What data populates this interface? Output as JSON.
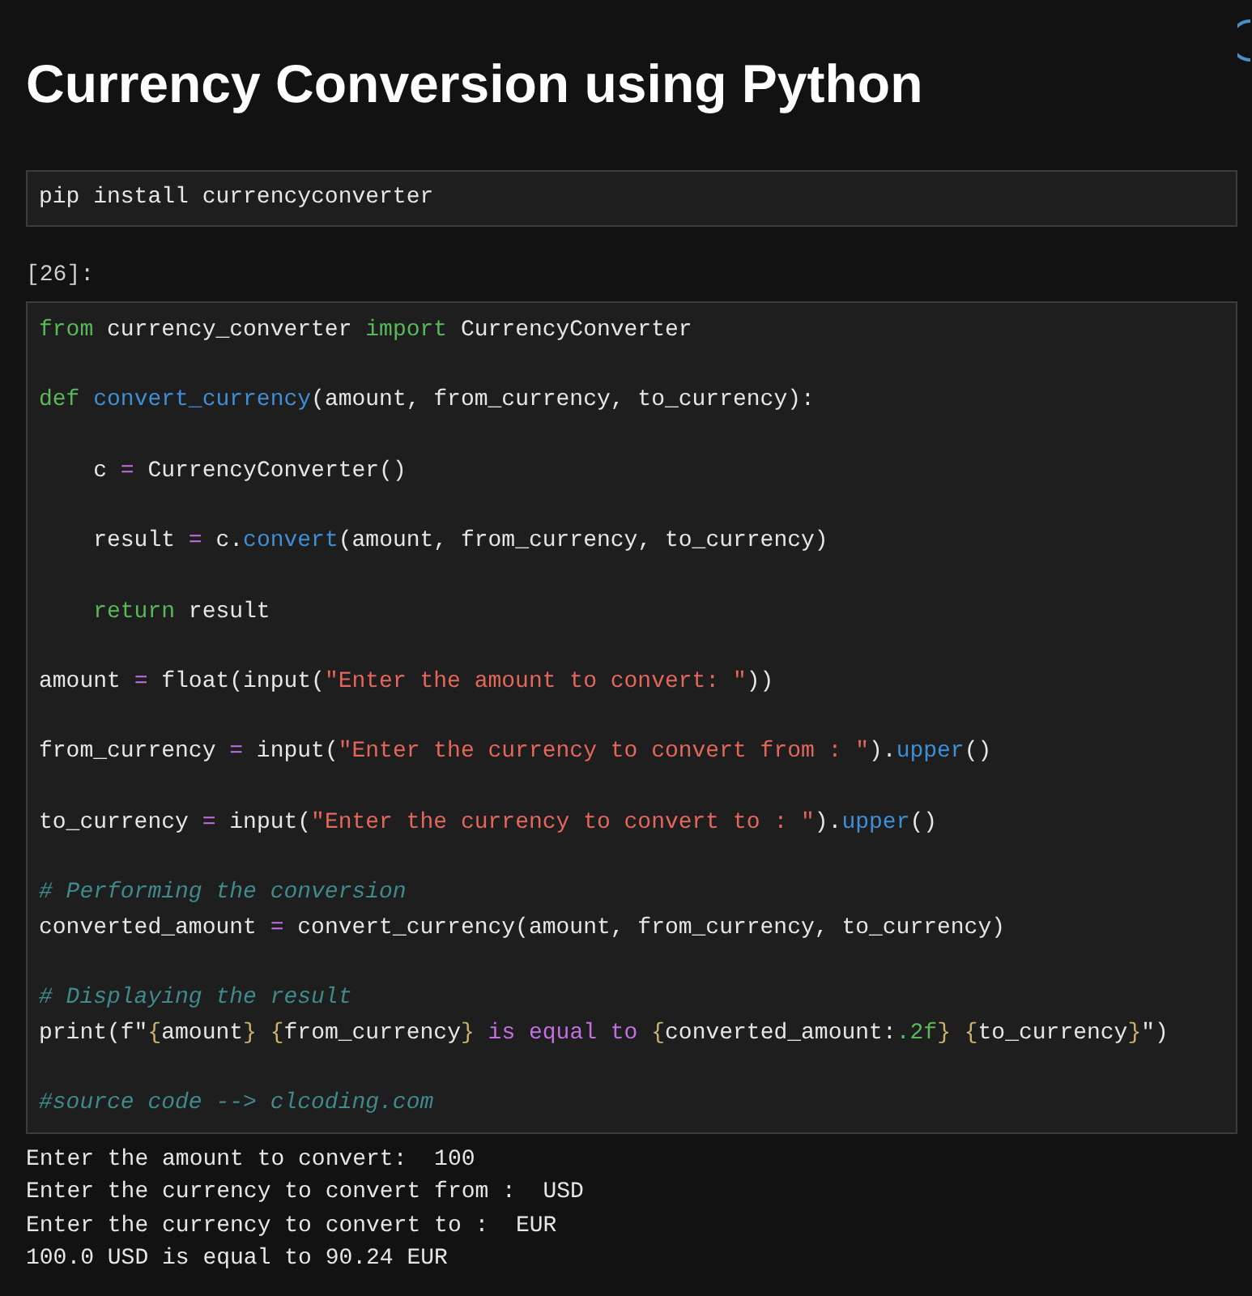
{
  "title": "Currency Conversion using Python",
  "install_cell": {
    "code": "pip install currencyconverter"
  },
  "prompt": "[26]:",
  "code_cell": {
    "lines": [
      {
        "kind": "code",
        "tokens": [
          {
            "text": "from",
            "kind": "keyword"
          },
          {
            "text": " currency_converter ",
            "kind": "plain"
          },
          {
            "text": "import",
            "kind": "keyword"
          },
          {
            "text": " CurrencyConverter",
            "kind": "plain"
          }
        ]
      },
      {
        "kind": "blank"
      },
      {
        "kind": "code",
        "tokens": [
          {
            "text": "def",
            "kind": "keyword"
          },
          {
            "text": " convert_currency",
            "kind": "function"
          },
          {
            "text": "(amount, from_currency, to_currency):",
            "kind": "plain"
          }
        ]
      },
      {
        "kind": "blank"
      },
      {
        "kind": "code",
        "tokens": [
          {
            "text": "    c ",
            "kind": "plain"
          },
          {
            "text": "=",
            "kind": "operator"
          },
          {
            "text": " CurrencyConverter()",
            "kind": "plain"
          }
        ]
      },
      {
        "kind": "blank"
      },
      {
        "kind": "code",
        "tokens": [
          {
            "text": "    result ",
            "kind": "plain"
          },
          {
            "text": "=",
            "kind": "operator"
          },
          {
            "text": " c.",
            "kind": "plain"
          },
          {
            "text": "convert",
            "kind": "function"
          },
          {
            "text": "(amount, from_currency, to_currency)",
            "kind": "plain"
          }
        ]
      },
      {
        "kind": "blank"
      },
      {
        "kind": "code",
        "tokens": [
          {
            "text": "    return",
            "kind": "keyword"
          },
          {
            "text": " result",
            "kind": "plain"
          }
        ]
      },
      {
        "kind": "blank"
      },
      {
        "kind": "code",
        "tokens": [
          {
            "text": "amount ",
            "kind": "plain"
          },
          {
            "text": "=",
            "kind": "operator"
          },
          {
            "text": " float(input(",
            "kind": "plain"
          },
          {
            "text": "\"Enter the amount to convert: \"",
            "kind": "string"
          },
          {
            "text": "))",
            "kind": "plain"
          }
        ]
      },
      {
        "kind": "blank"
      },
      {
        "kind": "code",
        "tokens": [
          {
            "text": "from_currency ",
            "kind": "plain"
          },
          {
            "text": "=",
            "kind": "operator"
          },
          {
            "text": " input(",
            "kind": "plain"
          },
          {
            "text": "\"Enter the currency to convert from : \"",
            "kind": "string"
          },
          {
            "text": ").",
            "kind": "plain"
          },
          {
            "text": "upper",
            "kind": "function"
          },
          {
            "text": "()",
            "kind": "plain"
          }
        ]
      },
      {
        "kind": "blank"
      },
      {
        "kind": "code",
        "tokens": [
          {
            "text": "to_currency ",
            "kind": "plain"
          },
          {
            "text": "=",
            "kind": "operator"
          },
          {
            "text": " input(",
            "kind": "plain"
          },
          {
            "text": "\"Enter the currency to convert to : \"",
            "kind": "string"
          },
          {
            "text": ").",
            "kind": "plain"
          },
          {
            "text": "upper",
            "kind": "function"
          },
          {
            "text": "()",
            "kind": "plain"
          }
        ]
      },
      {
        "kind": "blank"
      },
      {
        "kind": "code",
        "tokens": [
          {
            "text": "# Performing the conversion",
            "kind": "comment"
          }
        ]
      },
      {
        "kind": "code",
        "tokens": [
          {
            "text": "converted_amount ",
            "kind": "plain"
          },
          {
            "text": "=",
            "kind": "operator"
          },
          {
            "text": " convert_currency(amount, from_currency, to_currency)",
            "kind": "plain"
          }
        ]
      },
      {
        "kind": "blank"
      },
      {
        "kind": "code",
        "tokens": [
          {
            "text": "# Displaying the result",
            "kind": "comment"
          }
        ]
      },
      {
        "kind": "code",
        "tokens": [
          {
            "text": "print(f\"",
            "kind": "plain"
          },
          {
            "text": "{",
            "kind": "brace"
          },
          {
            "text": "amount",
            "kind": "plain"
          },
          {
            "text": "}",
            "kind": "brace"
          },
          {
            "text": " {",
            "kind": "brace"
          },
          {
            "text": "from_currency",
            "kind": "plain"
          },
          {
            "text": "}",
            "kind": "brace"
          },
          {
            "text": " is equal to ",
            "kind": "fstring"
          },
          {
            "text": "{",
            "kind": "brace"
          },
          {
            "text": "converted_amount:",
            "kind": "plain"
          },
          {
            "text": ".2f",
            "kind": "format"
          },
          {
            "text": "}",
            "kind": "brace"
          },
          {
            "text": " {",
            "kind": "brace"
          },
          {
            "text": "to_currency",
            "kind": "plain"
          },
          {
            "text": "}",
            "kind": "brace"
          },
          {
            "text": "\")",
            "kind": "plain"
          }
        ]
      },
      {
        "kind": "blank"
      },
      {
        "kind": "code",
        "tokens": [
          {
            "text": "#source code --> clcoding.com",
            "kind": "comment"
          }
        ]
      }
    ]
  },
  "output": [
    "Enter the amount to convert:  100",
    "Enter the currency to convert from :  USD",
    "Enter the currency to convert to :  EUR",
    "100.0 USD is equal to 90.24 EUR"
  ]
}
